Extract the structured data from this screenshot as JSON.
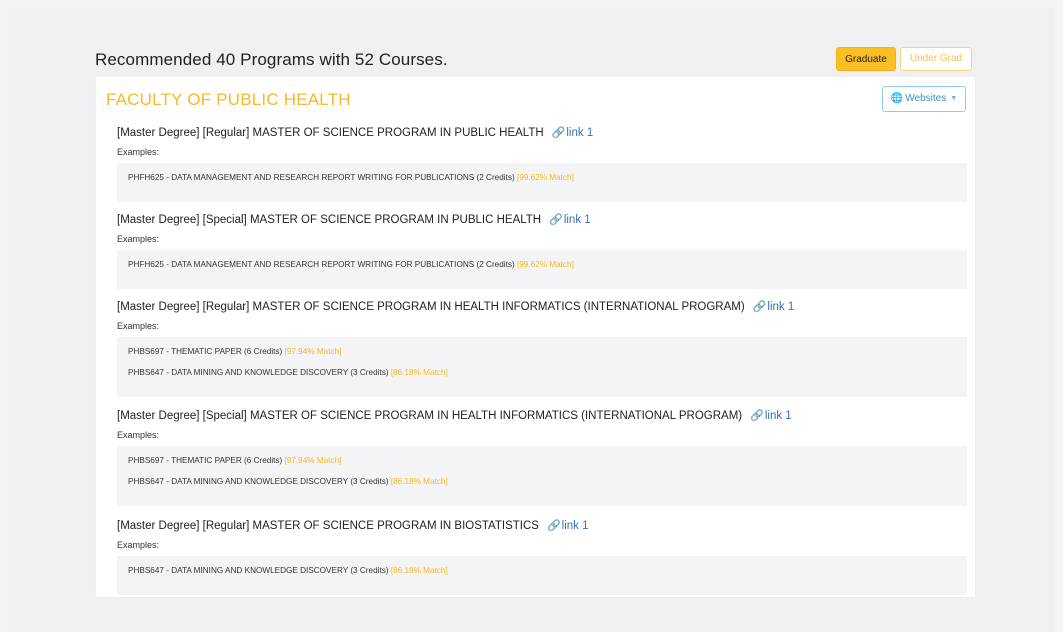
{
  "header": {
    "title": "Recommended 40 Programs with 52 Courses.",
    "graduate_label": "Graduate",
    "undergrad_label": "Under Grad"
  },
  "faculty": {
    "name": "FACULTY OF PUBLIC HEALTH",
    "websites_label": "Websites"
  },
  "examples_label": "Examples:",
  "link_label": "link 1",
  "colors": {
    "accent": "#fbbf24",
    "faculty_title": "#f7b928",
    "link": "#3b6fb6",
    "examples_bg": "#f4f4f6"
  },
  "programs": [
    {
      "title": "[Master Degree] [Regular] MASTER OF SCIENCE PROGRAM IN PUBLIC HEALTH",
      "courses": [
        {
          "text": "PHFH625 - DATA MANAGEMENT AND RESEARCH REPORT WRITING FOR PUBLICATIONS (2 Credits)",
          "match": "[99.62% Match]"
        }
      ]
    },
    {
      "title": "[Master Degree] [Special] MASTER OF SCIENCE PROGRAM IN PUBLIC HEALTH",
      "courses": [
        {
          "text": "PHFH625 - DATA MANAGEMENT AND RESEARCH REPORT WRITING FOR PUBLICATIONS (2 Credits)",
          "match": "[99.62% Match]"
        }
      ]
    },
    {
      "title": "[Master Degree] [Regular] MASTER OF SCIENCE PROGRAM IN HEALTH INFORMATICS (INTERNATIONAL PROGRAM)",
      "courses": [
        {
          "text": "PHBS697 - THEMATIC PAPER (6 Credits)",
          "match": "[97.94% Match]"
        },
        {
          "text": "PHBS647 - DATA MINING AND KNOWLEDGE DISCOVERY (3 Credits)",
          "match": "[86.18% Match]"
        }
      ]
    },
    {
      "title": "[Master Degree] [Special] MASTER OF SCIENCE PROGRAM IN HEALTH INFORMATICS (INTERNATIONAL PROGRAM)",
      "courses": [
        {
          "text": "PHBS697 - THEMATIC PAPER (6 Credits)",
          "match": "[97.94% Match]"
        },
        {
          "text": "PHBS647 - DATA MINING AND KNOWLEDGE DISCOVERY (3 Credits)",
          "match": "[86.18% Match]"
        }
      ]
    },
    {
      "title": "[Master Degree] [Regular] MASTER OF SCIENCE PROGRAM IN BIOSTATISTICS",
      "courses": [
        {
          "text": "PHBS647 - DATA MINING AND KNOWLEDGE DISCOVERY (3 Credits)",
          "match": "[86.18% Match]"
        }
      ]
    }
  ]
}
